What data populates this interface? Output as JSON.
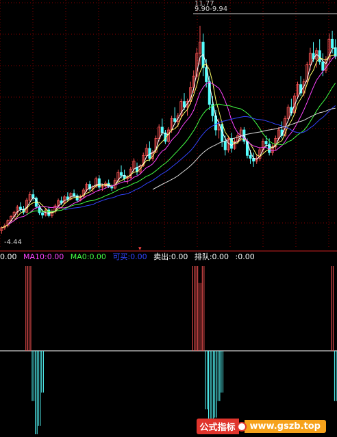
{
  "colors": {
    "background": "#000000",
    "grid": "#8b0000",
    "up_candle": "#ff5555",
    "down_candle": "#55ffff",
    "ma_white": "#ffffff",
    "ma_yellow": "#ffff66",
    "ma_magenta": "#ff44ff",
    "ma_green": "#44ff44",
    "ma_blue": "#3344ff",
    "long_line": "#dddddd"
  },
  "price_labels": {
    "high": "11.77",
    "range": "9.90-9.94",
    "low": "4.44"
  },
  "legend": {
    "item1": "0.00",
    "item2": "MA10:0.00",
    "item3": "MA0:0.00",
    "item4": "可买:0.00",
    "item5": "卖出:0.00",
    "item6": "排队:0.00",
    "item7": ":0.00"
  },
  "watermark": {
    "left": "公式指标",
    "right": "www.gszb.top"
  },
  "chart_data": [
    {
      "type": "candlestick",
      "title": "",
      "annotations": [
        "11.77",
        "9.90-9.94",
        "4.44"
      ],
      "ylim": [
        4.0,
        12.2
      ],
      "grid": true,
      "candles": [
        [
          4.55,
          4.7,
          4.44,
          4.65
        ],
        [
          4.65,
          4.8,
          4.58,
          4.72
        ],
        [
          4.72,
          4.95,
          4.66,
          4.9
        ],
        [
          4.9,
          5.1,
          4.84,
          5.05
        ],
        [
          5.05,
          5.25,
          4.96,
          5.2
        ],
        [
          5.2,
          5.45,
          5.1,
          5.38
        ],
        [
          5.38,
          5.55,
          5.2,
          5.3
        ],
        [
          5.3,
          5.42,
          5.12,
          5.2
        ],
        [
          5.2,
          5.7,
          5.16,
          5.62
        ],
        [
          5.62,
          5.92,
          5.55,
          5.82
        ],
        [
          5.82,
          6.0,
          5.6,
          5.7
        ],
        [
          5.7,
          5.75,
          5.3,
          5.4
        ],
        [
          5.4,
          5.45,
          5.1,
          5.18
        ],
        [
          5.18,
          5.3,
          4.98,
          5.1
        ],
        [
          5.1,
          5.35,
          5.05,
          5.28
        ],
        [
          5.28,
          5.4,
          5.02,
          5.08
        ],
        [
          5.08,
          5.3,
          5.0,
          5.22
        ],
        [
          5.22,
          5.5,
          5.15,
          5.42
        ],
        [
          5.42,
          5.68,
          5.36,
          5.6
        ],
        [
          5.6,
          5.75,
          5.45,
          5.52
        ],
        [
          5.52,
          5.8,
          5.48,
          5.74
        ],
        [
          5.74,
          5.9,
          5.6,
          5.66
        ],
        [
          5.66,
          5.9,
          5.62,
          5.86
        ],
        [
          5.86,
          6.0,
          5.7,
          5.78
        ],
        [
          5.78,
          5.85,
          5.55,
          5.62
        ],
        [
          5.62,
          5.82,
          5.58,
          5.76
        ],
        [
          5.76,
          6.05,
          5.7,
          5.98
        ],
        [
          5.98,
          6.25,
          5.9,
          6.18
        ],
        [
          6.18,
          6.3,
          5.95,
          6.02
        ],
        [
          6.02,
          6.15,
          5.9,
          6.1
        ],
        [
          6.1,
          6.45,
          6.05,
          6.38
        ],
        [
          6.38,
          6.5,
          6.0,
          6.08
        ],
        [
          6.08,
          6.2,
          5.95,
          6.12
        ],
        [
          6.12,
          6.3,
          6.05,
          6.22
        ],
        [
          6.22,
          6.35,
          6.05,
          6.1
        ],
        [
          6.1,
          6.18,
          5.95,
          6.05
        ],
        [
          6.05,
          6.4,
          6.0,
          6.32
        ],
        [
          6.32,
          6.7,
          6.28,
          6.6
        ],
        [
          6.6,
          6.85,
          6.4,
          6.5
        ],
        [
          6.5,
          6.7,
          6.3,
          6.38
        ],
        [
          6.38,
          6.5,
          6.2,
          6.42
        ],
        [
          6.42,
          6.8,
          6.38,
          6.72
        ],
        [
          6.72,
          7.1,
          6.6,
          7.0
        ],
        [
          6.78,
          6.95,
          6.5,
          6.62
        ],
        [
          6.62,
          6.9,
          6.55,
          6.84
        ],
        [
          6.84,
          7.3,
          6.8,
          7.2
        ],
        [
          7.2,
          7.6,
          7.1,
          7.45
        ],
        [
          7.45,
          7.7,
          7.0,
          7.1
        ],
        [
          7.1,
          7.4,
          7.0,
          7.32
        ],
        [
          7.32,
          7.9,
          7.28,
          7.8
        ],
        [
          7.8,
          8.3,
          7.7,
          8.2
        ],
        [
          8.2,
          8.5,
          7.9,
          8.0
        ],
        [
          8.0,
          8.1,
          7.6,
          7.7
        ],
        [
          7.7,
          8.2,
          7.65,
          8.1
        ],
        [
          8.1,
          8.6,
          8.0,
          8.5
        ],
        [
          8.5,
          8.9,
          8.3,
          8.4
        ],
        [
          8.4,
          8.7,
          8.2,
          8.6
        ],
        [
          8.6,
          9.2,
          8.5,
          9.1
        ],
        [
          9.1,
          9.4,
          8.8,
          8.9
        ],
        [
          8.9,
          9.2,
          8.6,
          9.1
        ],
        [
          9.1,
          9.8,
          9.0,
          9.6
        ],
        [
          9.6,
          10.2,
          9.4,
          10.0
        ],
        [
          10.0,
          11.0,
          9.9,
          10.8
        ],
        [
          10.8,
          11.77,
          10.4,
          11.2
        ],
        [
          11.2,
          11.5,
          10.0,
          10.3
        ],
        [
          10.3,
          10.6,
          9.6,
          9.8
        ],
        [
          9.8,
          10.0,
          8.8,
          9.0
        ],
        [
          9.0,
          9.3,
          8.4,
          8.6
        ],
        [
          8.6,
          8.8,
          7.9,
          8.1
        ],
        [
          8.1,
          8.5,
          7.8,
          8.3
        ],
        [
          8.3,
          8.4,
          7.5,
          7.7
        ],
        [
          7.7,
          7.9,
          7.2,
          7.4
        ],
        [
          7.4,
          7.9,
          7.3,
          7.8
        ],
        [
          7.8,
          8.0,
          7.3,
          7.45
        ],
        [
          7.45,
          7.8,
          7.4,
          7.7
        ],
        [
          7.7,
          8.0,
          7.6,
          7.9
        ],
        [
          7.9,
          8.2,
          7.7,
          8.1
        ],
        [
          8.1,
          8.2,
          7.6,
          7.7
        ],
        [
          7.7,
          7.8,
          7.1,
          7.2
        ],
        [
          7.2,
          7.4,
          6.9,
          7.1
        ],
        [
          7.1,
          7.3,
          6.8,
          7.0
        ],
        [
          7.0,
          7.2,
          6.9,
          7.1
        ],
        [
          7.1,
          7.5,
          7.0,
          7.4
        ],
        [
          7.4,
          7.8,
          7.3,
          7.7
        ],
        [
          7.7,
          7.9,
          7.5,
          7.6
        ],
        [
          7.6,
          7.8,
          7.2,
          7.3
        ],
        [
          7.3,
          7.6,
          7.2,
          7.5
        ],
        [
          7.5,
          7.9,
          7.4,
          7.8
        ],
        [
          7.8,
          8.2,
          7.7,
          8.1
        ],
        [
          8.1,
          8.4,
          7.8,
          7.9
        ],
        [
          7.9,
          8.6,
          7.85,
          8.5
        ],
        [
          8.5,
          9.0,
          8.4,
          8.9
        ],
        [
          8.9,
          9.2,
          8.6,
          8.7
        ],
        [
          8.7,
          9.4,
          8.65,
          9.3
        ],
        [
          9.3,
          9.8,
          9.2,
          9.7
        ],
        [
          9.7,
          10.0,
          9.3,
          9.4
        ],
        [
          9.4,
          9.9,
          9.3,
          9.8
        ],
        [
          9.8,
          10.5,
          9.7,
          10.4
        ],
        [
          10.4,
          11.0,
          10.2,
          10.8
        ],
        [
          10.8,
          11.2,
          10.5,
          10.6
        ],
        [
          10.6,
          11.0,
          10.3,
          10.9
        ],
        [
          10.9,
          11.3,
          10.4,
          10.5
        ],
        [
          10.5,
          10.8,
          10.0,
          10.2
        ],
        [
          10.2,
          10.7,
          10.1,
          10.6
        ],
        [
          10.6,
          11.5,
          10.5,
          11.3
        ],
        [
          11.3,
          11.6,
          10.8,
          11.0
        ],
        [
          11.0,
          11.3,
          10.6,
          10.7
        ]
      ]
    },
    {
      "type": "bar",
      "title": "",
      "legend": [
        "0.00",
        "MA10:0.00",
        "MA0:0.00",
        "可买:0.00",
        "卖出:0.00",
        "排队:0.00",
        ":0.00"
      ],
      "ylim": [
        -1.0,
        1.0
      ],
      "grid": false,
      "series": [
        {
          "values": [
            0,
            0,
            0,
            0,
            0,
            0,
            0,
            0,
            1,
            1,
            -0.6,
            -1,
            -0.9,
            -0.5,
            0,
            0,
            0,
            0,
            0,
            0,
            0,
            0,
            0,
            0,
            0,
            0,
            0,
            0,
            0,
            0,
            0,
            0,
            0,
            0,
            0,
            0,
            0,
            0,
            0,
            0,
            0,
            0,
            0,
            0,
            0,
            0,
            0,
            0,
            0,
            0,
            0,
            0,
            0,
            0,
            0,
            0,
            0,
            0,
            0,
            0,
            0,
            1,
            1,
            0.8,
            1,
            -0.7,
            -0.9,
            -1,
            -0.8,
            -0.6,
            -0.5,
            0,
            0,
            0,
            0,
            0,
            0,
            0,
            0,
            0,
            0,
            0,
            0,
            0,
            0,
            0,
            0,
            0,
            0,
            0,
            0,
            0,
            0,
            0,
            0,
            0,
            0,
            0,
            0,
            0,
            0,
            0,
            0,
            0,
            0,
            1,
            -0.6,
            -1,
            -0.7,
            -0.4
          ]
        }
      ]
    }
  ]
}
